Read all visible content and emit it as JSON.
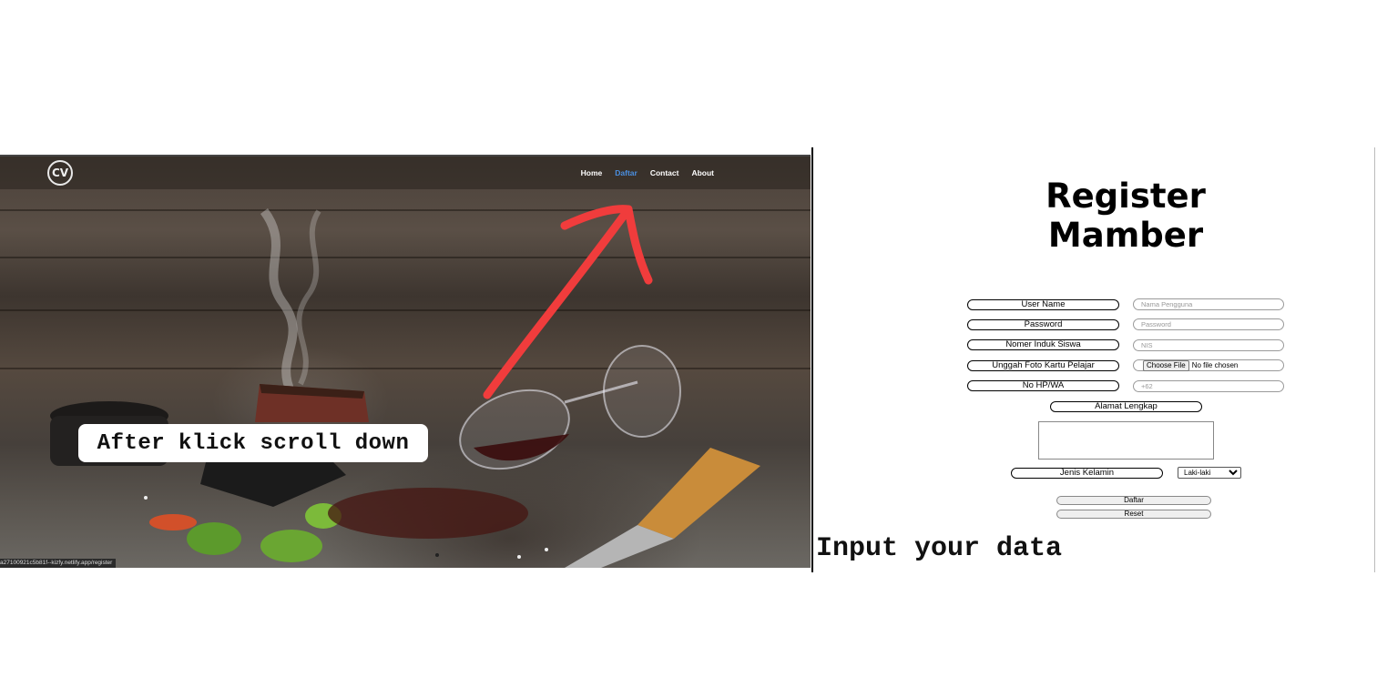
{
  "left_panel": {
    "nav": {
      "logo_text": "CV",
      "links": [
        "Home",
        "Daftar",
        "Contact",
        "About"
      ],
      "active_link": "Daftar"
    },
    "status_bar_url": "a27100921c5b81f--kizfy.netlify.app/register",
    "callout_text": "After klick scroll down",
    "arrow_color": "#f03c3c"
  },
  "right_panel": {
    "title": "Register Mamber",
    "fields": [
      {
        "label": "User Name",
        "placeholder": "Nama Pengguna"
      },
      {
        "label": "Password",
        "placeholder": "Password"
      },
      {
        "label": "Nomer Induk Siswa",
        "placeholder": "NIS"
      },
      {
        "label": "Unggah Foto Kartu Pelajar",
        "file_button": "Choose File",
        "file_status": "No file chosen"
      },
      {
        "label": "No HP/WA",
        "placeholder": "+62"
      }
    ],
    "address_label": "Alamat Lengkap",
    "gender_label": "Jenis Kelamin",
    "gender_selected": "Laki-laki",
    "submit_label": "Daftar",
    "reset_label": "Reset"
  },
  "caption": "Input your data"
}
